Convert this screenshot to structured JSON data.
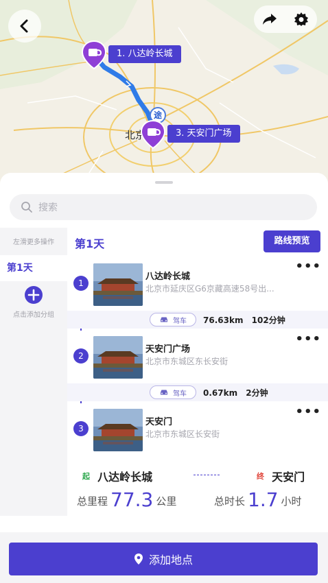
{
  "map": {
    "city_label": "北京",
    "via_label": "途",
    "pins": [
      {
        "label": "1. 八达岭长城"
      },
      {
        "label": "3. 天安门广场"
      }
    ]
  },
  "search": {
    "placeholder": "搜索"
  },
  "sidebar": {
    "hint": "左滑更多操作",
    "day_label": "第1天",
    "add_day_label": "点击添加分组"
  },
  "day": {
    "title": "第1天",
    "preview_button": "路线预览",
    "stops": [
      {
        "index": "1",
        "name": "八达岭长城",
        "address": "北京市延庆区G6京藏高速58号出..."
      },
      {
        "index": "2",
        "name": "天安门广场",
        "address": "北京市东城区东长安街"
      },
      {
        "index": "3",
        "name": "天安门",
        "address": "北京市东城区长安街"
      }
    ],
    "legs": [
      {
        "mode": "驾车",
        "distance": "76.63km",
        "duration": "102分钟"
      },
      {
        "mode": "驾车",
        "distance": "0.67km",
        "duration": "2分钟"
      }
    ]
  },
  "summary": {
    "start_tag": "起",
    "start_place": "八达岭长城",
    "end_tag": "终",
    "end_place": "天安门",
    "distance_label": "总里程",
    "distance_value": "77.3",
    "distance_unit": "公里",
    "duration_label": "总时长",
    "duration_value": "1.7",
    "duration_unit": "小时"
  },
  "bottom": {
    "add_place_label": "添加地点"
  },
  "colors": {
    "accent": "#4b3fcf",
    "route": "#2f7be8",
    "pin": "#8e3fd6"
  }
}
